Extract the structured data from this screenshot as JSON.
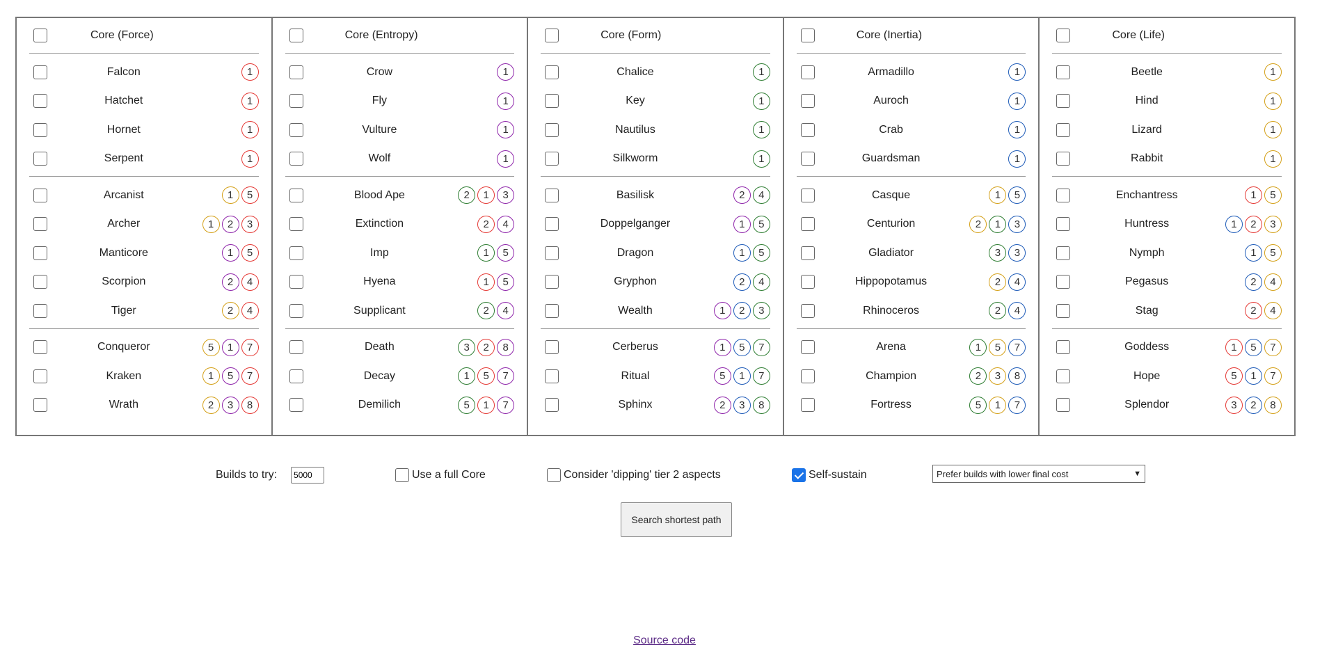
{
  "columns": [
    {
      "title": "Core (Force)",
      "sections": [
        [
          {
            "name": "Falcon",
            "badges": [
              {
                "n": "1",
                "c": "#e53935"
              }
            ]
          },
          {
            "name": "Hatchet",
            "badges": [
              {
                "n": "1",
                "c": "#e53935"
              }
            ]
          },
          {
            "name": "Hornet",
            "badges": [
              {
                "n": "1",
                "c": "#e53935"
              }
            ]
          },
          {
            "name": "Serpent",
            "badges": [
              {
                "n": "1",
                "c": "#e53935"
              }
            ]
          }
        ],
        [
          {
            "name": "Arcanist",
            "badges": [
              {
                "n": "1",
                "c": "#d4a017"
              },
              {
                "n": "5",
                "c": "#e53935"
              }
            ]
          },
          {
            "name": "Archer",
            "badges": [
              {
                "n": "1",
                "c": "#d4a017"
              },
              {
                "n": "2",
                "c": "#8e24aa"
              },
              {
                "n": "3",
                "c": "#e53935"
              }
            ]
          },
          {
            "name": "Manticore",
            "badges": [
              {
                "n": "1",
                "c": "#8e24aa"
              },
              {
                "n": "5",
                "c": "#e53935"
              }
            ]
          },
          {
            "name": "Scorpion",
            "badges": [
              {
                "n": "2",
                "c": "#8e24aa"
              },
              {
                "n": "4",
                "c": "#e53935"
              }
            ]
          },
          {
            "name": "Tiger",
            "badges": [
              {
                "n": "2",
                "c": "#d4a017"
              },
              {
                "n": "4",
                "c": "#e53935"
              }
            ]
          }
        ],
        [
          {
            "name": "Conqueror",
            "badges": [
              {
                "n": "5",
                "c": "#d4a017"
              },
              {
                "n": "1",
                "c": "#8e24aa"
              },
              {
                "n": "7",
                "c": "#e53935"
              }
            ]
          },
          {
            "name": "Kraken",
            "badges": [
              {
                "n": "1",
                "c": "#d4a017"
              },
              {
                "n": "5",
                "c": "#8e24aa"
              },
              {
                "n": "7",
                "c": "#e53935"
              }
            ]
          },
          {
            "name": "Wrath",
            "badges": [
              {
                "n": "2",
                "c": "#d4a017"
              },
              {
                "n": "3",
                "c": "#8e24aa"
              },
              {
                "n": "8",
                "c": "#e53935"
              }
            ]
          }
        ]
      ]
    },
    {
      "title": "Core (Entropy)",
      "sections": [
        [
          {
            "name": "Crow",
            "badges": [
              {
                "n": "1",
                "c": "#8e24aa"
              }
            ]
          },
          {
            "name": "Fly",
            "badges": [
              {
                "n": "1",
                "c": "#8e24aa"
              }
            ]
          },
          {
            "name": "Vulture",
            "badges": [
              {
                "n": "1",
                "c": "#8e24aa"
              }
            ]
          },
          {
            "name": "Wolf",
            "badges": [
              {
                "n": "1",
                "c": "#8e24aa"
              }
            ]
          }
        ],
        [
          {
            "name": "Blood Ape",
            "badges": [
              {
                "n": "2",
                "c": "#2e7d32"
              },
              {
                "n": "1",
                "c": "#e53935"
              },
              {
                "n": "3",
                "c": "#8e24aa"
              }
            ]
          },
          {
            "name": "Extinction",
            "badges": [
              {
                "n": "2",
                "c": "#e53935"
              },
              {
                "n": "4",
                "c": "#8e24aa"
              }
            ]
          },
          {
            "name": "Imp",
            "badges": [
              {
                "n": "1",
                "c": "#2e7d32"
              },
              {
                "n": "5",
                "c": "#8e24aa"
              }
            ]
          },
          {
            "name": "Hyena",
            "badges": [
              {
                "n": "1",
                "c": "#e53935"
              },
              {
                "n": "5",
                "c": "#8e24aa"
              }
            ]
          },
          {
            "name": "Supplicant",
            "badges": [
              {
                "n": "2",
                "c": "#2e7d32"
              },
              {
                "n": "4",
                "c": "#8e24aa"
              }
            ]
          }
        ],
        [
          {
            "name": "Death",
            "badges": [
              {
                "n": "3",
                "c": "#2e7d32"
              },
              {
                "n": "2",
                "c": "#e53935"
              },
              {
                "n": "8",
                "c": "#8e24aa"
              }
            ]
          },
          {
            "name": "Decay",
            "badges": [
              {
                "n": "1",
                "c": "#2e7d32"
              },
              {
                "n": "5",
                "c": "#e53935"
              },
              {
                "n": "7",
                "c": "#8e24aa"
              }
            ]
          },
          {
            "name": "Demilich",
            "badges": [
              {
                "n": "5",
                "c": "#2e7d32"
              },
              {
                "n": "1",
                "c": "#e53935"
              },
              {
                "n": "7",
                "c": "#8e24aa"
              }
            ]
          }
        ]
      ]
    },
    {
      "title": "Core (Form)",
      "sections": [
        [
          {
            "name": "Chalice",
            "badges": [
              {
                "n": "1",
                "c": "#2e7d32"
              }
            ]
          },
          {
            "name": "Key",
            "badges": [
              {
                "n": "1",
                "c": "#2e7d32"
              }
            ]
          },
          {
            "name": "Nautilus",
            "badges": [
              {
                "n": "1",
                "c": "#2e7d32"
              }
            ]
          },
          {
            "name": "Silkworm",
            "badges": [
              {
                "n": "1",
                "c": "#2e7d32"
              }
            ]
          }
        ],
        [
          {
            "name": "Basilisk",
            "badges": [
              {
                "n": "2",
                "c": "#8e24aa"
              },
              {
                "n": "4",
                "c": "#2e7d32"
              }
            ]
          },
          {
            "name": "Doppelganger",
            "badges": [
              {
                "n": "1",
                "c": "#8e24aa"
              },
              {
                "n": "5",
                "c": "#2e7d32"
              }
            ]
          },
          {
            "name": "Dragon",
            "badges": [
              {
                "n": "1",
                "c": "#1e5bb8"
              },
              {
                "n": "5",
                "c": "#2e7d32"
              }
            ]
          },
          {
            "name": "Gryphon",
            "badges": [
              {
                "n": "2",
                "c": "#1e5bb8"
              },
              {
                "n": "4",
                "c": "#2e7d32"
              }
            ]
          },
          {
            "name": "Wealth",
            "badges": [
              {
                "n": "1",
                "c": "#8e24aa"
              },
              {
                "n": "2",
                "c": "#1e5bb8"
              },
              {
                "n": "3",
                "c": "#2e7d32"
              }
            ]
          }
        ],
        [
          {
            "name": "Cerberus",
            "badges": [
              {
                "n": "1",
                "c": "#8e24aa"
              },
              {
                "n": "5",
                "c": "#1e5bb8"
              },
              {
                "n": "7",
                "c": "#2e7d32"
              }
            ]
          },
          {
            "name": "Ritual",
            "badges": [
              {
                "n": "5",
                "c": "#8e24aa"
              },
              {
                "n": "1",
                "c": "#1e5bb8"
              },
              {
                "n": "7",
                "c": "#2e7d32"
              }
            ]
          },
          {
            "name": "Sphinx",
            "badges": [
              {
                "n": "2",
                "c": "#8e24aa"
              },
              {
                "n": "3",
                "c": "#1e5bb8"
              },
              {
                "n": "8",
                "c": "#2e7d32"
              }
            ]
          }
        ]
      ]
    },
    {
      "title": "Core (Inertia)",
      "sections": [
        [
          {
            "name": "Armadillo",
            "badges": [
              {
                "n": "1",
                "c": "#1e5bb8"
              }
            ]
          },
          {
            "name": "Auroch",
            "badges": [
              {
                "n": "1",
                "c": "#1e5bb8"
              }
            ]
          },
          {
            "name": "Crab",
            "badges": [
              {
                "n": "1",
                "c": "#1e5bb8"
              }
            ]
          },
          {
            "name": "Guardsman",
            "badges": [
              {
                "n": "1",
                "c": "#1e5bb8"
              }
            ]
          }
        ],
        [
          {
            "name": "Casque",
            "badges": [
              {
                "n": "1",
                "c": "#d4a017"
              },
              {
                "n": "5",
                "c": "#1e5bb8"
              }
            ]
          },
          {
            "name": "Centurion",
            "badges": [
              {
                "n": "2",
                "c": "#d4a017"
              },
              {
                "n": "1",
                "c": "#2e7d32"
              },
              {
                "n": "3",
                "c": "#1e5bb8"
              }
            ]
          },
          {
            "name": "Gladiator",
            "badges": [
              {
                "n": "3",
                "c": "#2e7d32"
              },
              {
                "n": "3",
                "c": "#1e5bb8"
              }
            ]
          },
          {
            "name": "Hippopotamus",
            "badges": [
              {
                "n": "2",
                "c": "#d4a017"
              },
              {
                "n": "4",
                "c": "#1e5bb8"
              }
            ]
          },
          {
            "name": "Rhinoceros",
            "badges": [
              {
                "n": "2",
                "c": "#2e7d32"
              },
              {
                "n": "4",
                "c": "#1e5bb8"
              }
            ]
          }
        ],
        [
          {
            "name": "Arena",
            "badges": [
              {
                "n": "1",
                "c": "#2e7d32"
              },
              {
                "n": "5",
                "c": "#d4a017"
              },
              {
                "n": "7",
                "c": "#1e5bb8"
              }
            ]
          },
          {
            "name": "Champion",
            "badges": [
              {
                "n": "2",
                "c": "#2e7d32"
              },
              {
                "n": "3",
                "c": "#d4a017"
              },
              {
                "n": "8",
                "c": "#1e5bb8"
              }
            ]
          },
          {
            "name": "Fortress",
            "badges": [
              {
                "n": "5",
                "c": "#2e7d32"
              },
              {
                "n": "1",
                "c": "#d4a017"
              },
              {
                "n": "7",
                "c": "#1e5bb8"
              }
            ]
          }
        ]
      ]
    },
    {
      "title": "Core (Life)",
      "sections": [
        [
          {
            "name": "Beetle",
            "badges": [
              {
                "n": "1",
                "c": "#d4a017"
              }
            ]
          },
          {
            "name": "Hind",
            "badges": [
              {
                "n": "1",
                "c": "#d4a017"
              }
            ]
          },
          {
            "name": "Lizard",
            "badges": [
              {
                "n": "1",
                "c": "#d4a017"
              }
            ]
          },
          {
            "name": "Rabbit",
            "badges": [
              {
                "n": "1",
                "c": "#d4a017"
              }
            ]
          }
        ],
        [
          {
            "name": "Enchantress",
            "badges": [
              {
                "n": "1",
                "c": "#e53935"
              },
              {
                "n": "5",
                "c": "#d4a017"
              }
            ]
          },
          {
            "name": "Huntress",
            "badges": [
              {
                "n": "1",
                "c": "#1e5bb8"
              },
              {
                "n": "2",
                "c": "#e53935"
              },
              {
                "n": "3",
                "c": "#d4a017"
              }
            ]
          },
          {
            "name": "Nymph",
            "badges": [
              {
                "n": "1",
                "c": "#1e5bb8"
              },
              {
                "n": "5",
                "c": "#d4a017"
              }
            ]
          },
          {
            "name": "Pegasus",
            "badges": [
              {
                "n": "2",
                "c": "#1e5bb8"
              },
              {
                "n": "4",
                "c": "#d4a017"
              }
            ]
          },
          {
            "name": "Stag",
            "badges": [
              {
                "n": "2",
                "c": "#e53935"
              },
              {
                "n": "4",
                "c": "#d4a017"
              }
            ]
          }
        ],
        [
          {
            "name": "Goddess",
            "badges": [
              {
                "n": "1",
                "c": "#e53935"
              },
              {
                "n": "5",
                "c": "#1e5bb8"
              },
              {
                "n": "7",
                "c": "#d4a017"
              }
            ]
          },
          {
            "name": "Hope",
            "badges": [
              {
                "n": "5",
                "c": "#e53935"
              },
              {
                "n": "1",
                "c": "#1e5bb8"
              },
              {
                "n": "7",
                "c": "#d4a017"
              }
            ]
          },
          {
            "name": "Splendor",
            "badges": [
              {
                "n": "3",
                "c": "#e53935"
              },
              {
                "n": "2",
                "c": "#1e5bb8"
              },
              {
                "n": "8",
                "c": "#d4a017"
              }
            ]
          }
        ]
      ]
    }
  ],
  "controls": {
    "builds_label": "Builds to try:",
    "builds_value": "5000",
    "full_core_label": "Use a full Core",
    "full_core_checked": false,
    "dipping_label": "Consider 'dipping' tier 2 aspects",
    "dipping_checked": false,
    "self_sustain_label": "Self-sustain",
    "self_sustain_checked": true,
    "sort_selected": "Prefer builds with lower final cost"
  },
  "search_button": "Search shortest path",
  "source_link": "Source code"
}
